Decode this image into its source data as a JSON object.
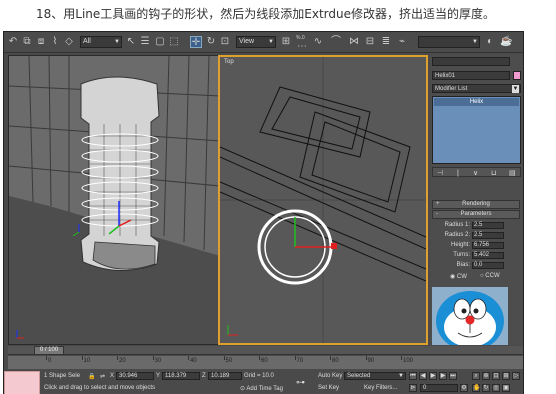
{
  "caption": "18、用Line工具画的钩子的形状，然后为线段添加Extrdue修改器，挤出适当的厚度。",
  "toolbar": {
    "selection_filter": "All",
    "coordinate_system": "View",
    "percent_label": "%.0"
  },
  "viewports": {
    "right_label": "Top"
  },
  "command_panel": {
    "object_name": "Helix01",
    "object_color": "#f29bd0",
    "modifier_list": "Modifier List",
    "stack_item": "Helix",
    "rollout_rendering": "Rendering",
    "rollout_parameters": "Parameters",
    "rendering_sign": "+",
    "parameters_sign": "-",
    "params": [
      {
        "label": "Radius 1:",
        "value": "2.5"
      },
      {
        "label": "Radius 2:",
        "value": "2.5"
      },
      {
        "label": "Height:",
        "value": "6.756"
      },
      {
        "label": "Turns:",
        "value": "5.402"
      },
      {
        "label": "Bias:",
        "value": "0.0"
      }
    ],
    "cw_label": "CW",
    "ccw_label": "CCW"
  },
  "timeline": {
    "frame_counter": "0 / 100",
    "ticks": [
      "0",
      "10",
      "20",
      "30",
      "40",
      "50",
      "60",
      "70",
      "80",
      "90",
      "100"
    ]
  },
  "status": {
    "selection_text": "1 Shape Sele",
    "prompt_text": "Click and drag to select and move objects",
    "x_label": "X",
    "x_value": "30.946",
    "y_label": "Y",
    "y_value": "118.379",
    "z_label": "Z",
    "z_value": "10.189",
    "grid_text": "Grid = 10.0",
    "add_time_tag": "Add Time Tag",
    "auto_key": "Auto Key",
    "selected": "Selected",
    "set_key": "Set Key",
    "key_filters": "Key Filters...",
    "frame_value": "0"
  }
}
